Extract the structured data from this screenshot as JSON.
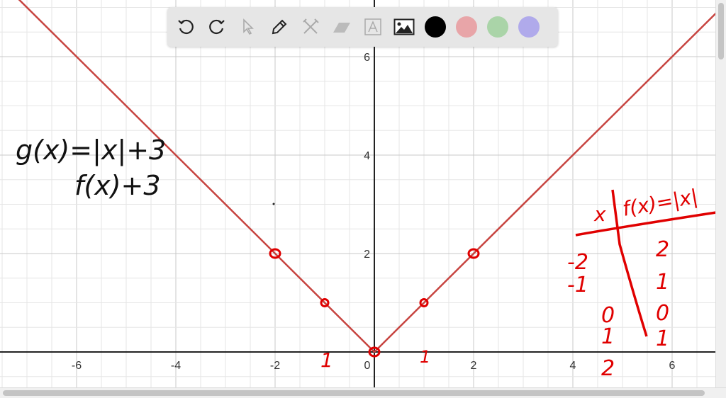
{
  "toolbar": {
    "tools": [
      "undo-icon",
      "redo-icon",
      "select-icon",
      "pen-icon",
      "tools-icon",
      "eraser-icon",
      "text-icon",
      "image-icon"
    ],
    "colors": [
      "#000000",
      "#e8a5a8",
      "#aad4a8",
      "#b0aaeb"
    ]
  },
  "chart_data": {
    "type": "line",
    "title": "",
    "xlabel": "",
    "ylabel": "",
    "xlim": [
      -7.54,
      6.9
    ],
    "ylim": [
      -0.7,
      7.1
    ],
    "grid": true,
    "minor_step": 0.5,
    "x_ticks": [
      -6,
      -4,
      -2,
      0,
      2,
      4,
      6
    ],
    "x_tick_labels": [
      "-6",
      "-4",
      "-2",
      "0",
      "2",
      "4",
      "6"
    ],
    "y_ticks": [
      2,
      4,
      6
    ],
    "y_tick_labels": [
      "2",
      "4",
      "6"
    ],
    "series": [
      {
        "name": "f(x)=|x|",
        "color": "#c74440",
        "function": "abs",
        "x": [
          -7.54,
          0,
          6.9
        ],
        "y": [
          7.54,
          0,
          6.9
        ]
      }
    ],
    "points": [
      {
        "x": -2,
        "y": 2
      },
      {
        "x": -1,
        "y": 1
      },
      {
        "x": 0,
        "y": 0
      },
      {
        "x": 1,
        "y": 1
      },
      {
        "x": 2,
        "y": 2
      }
    ],
    "annotations": {
      "line1": "g(x)=|x|+3",
      "line2": "f(x)+3",
      "below_neg1": "1",
      "below_pos1": "1",
      "table_header_x": "x",
      "table_header_f": "f(x)=|x|",
      "table_x": [
        "-2",
        "-1",
        "0",
        "1",
        "2"
      ],
      "table_f": [
        "2",
        "1",
        "0",
        "1"
      ]
    }
  }
}
